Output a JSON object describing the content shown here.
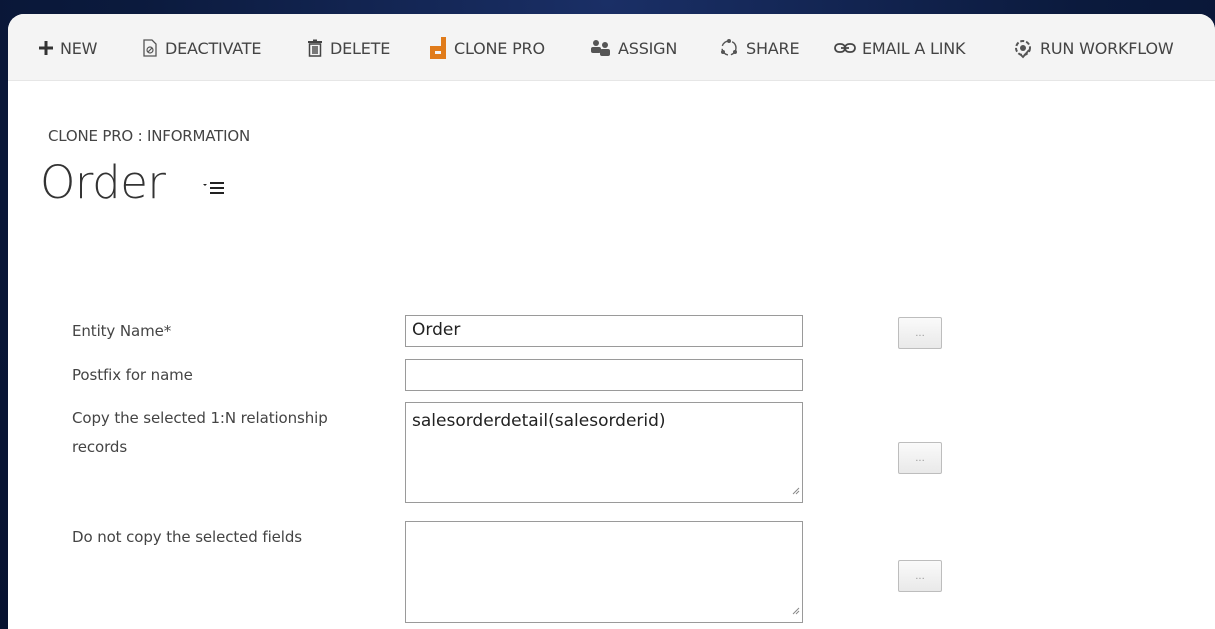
{
  "toolbar": {
    "new": "NEW",
    "deactivate": "DEACTIVATE",
    "delete": "DELETE",
    "clone_pro": "CLONE PRO",
    "assign": "ASSIGN",
    "share": "SHARE",
    "email_link": "EMAIL A LINK",
    "run_workflow": "RUN WORKFLOW"
  },
  "header": {
    "breadcrumb": "CLONE PRO : INFORMATION",
    "title": "Order"
  },
  "form": {
    "entity_name_label": "Entity Name*",
    "entity_name_value": "Order",
    "postfix_label": "Postfix for name",
    "postfix_value": "",
    "relationships_label_line1": "Copy the selected 1:N relationship",
    "relationships_label_line2": "records",
    "relationships_value": "salesorderdetail(salesorderid)",
    "exclude_fields_label": "Do not copy the selected fields",
    "exclude_fields_value": "",
    "lookup_label": "...",
    "colors": {
      "clone_pro_accent": "#e07b1a",
      "text": "#444444"
    }
  }
}
